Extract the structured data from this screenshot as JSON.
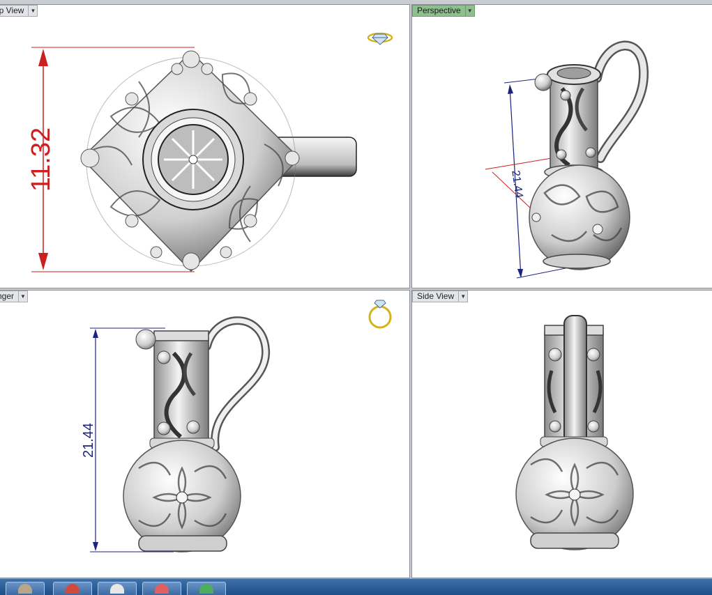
{
  "viewports": {
    "top": {
      "title": "Top View"
    },
    "perspective": {
      "title": "Perspective"
    },
    "front": {
      "title": "Finger"
    },
    "side": {
      "title": "Side View"
    }
  },
  "dimensions": {
    "top_height": "11.32",
    "front_height": "21.44",
    "perspective_height": "21.44"
  },
  "icons": {
    "top_gem": "gem-ring-icon",
    "front_ring": "ring-icon"
  },
  "colors": {
    "active_viewport_tab": "#8fbf8f",
    "dimension_red": "#cc1f1f",
    "dimension_blue": "#1a237e",
    "gem_icon": "#d4b21a"
  },
  "taskbar": {
    "buttons": [
      "app-1",
      "app-2",
      "app-3",
      "app-4",
      "app-5"
    ]
  }
}
